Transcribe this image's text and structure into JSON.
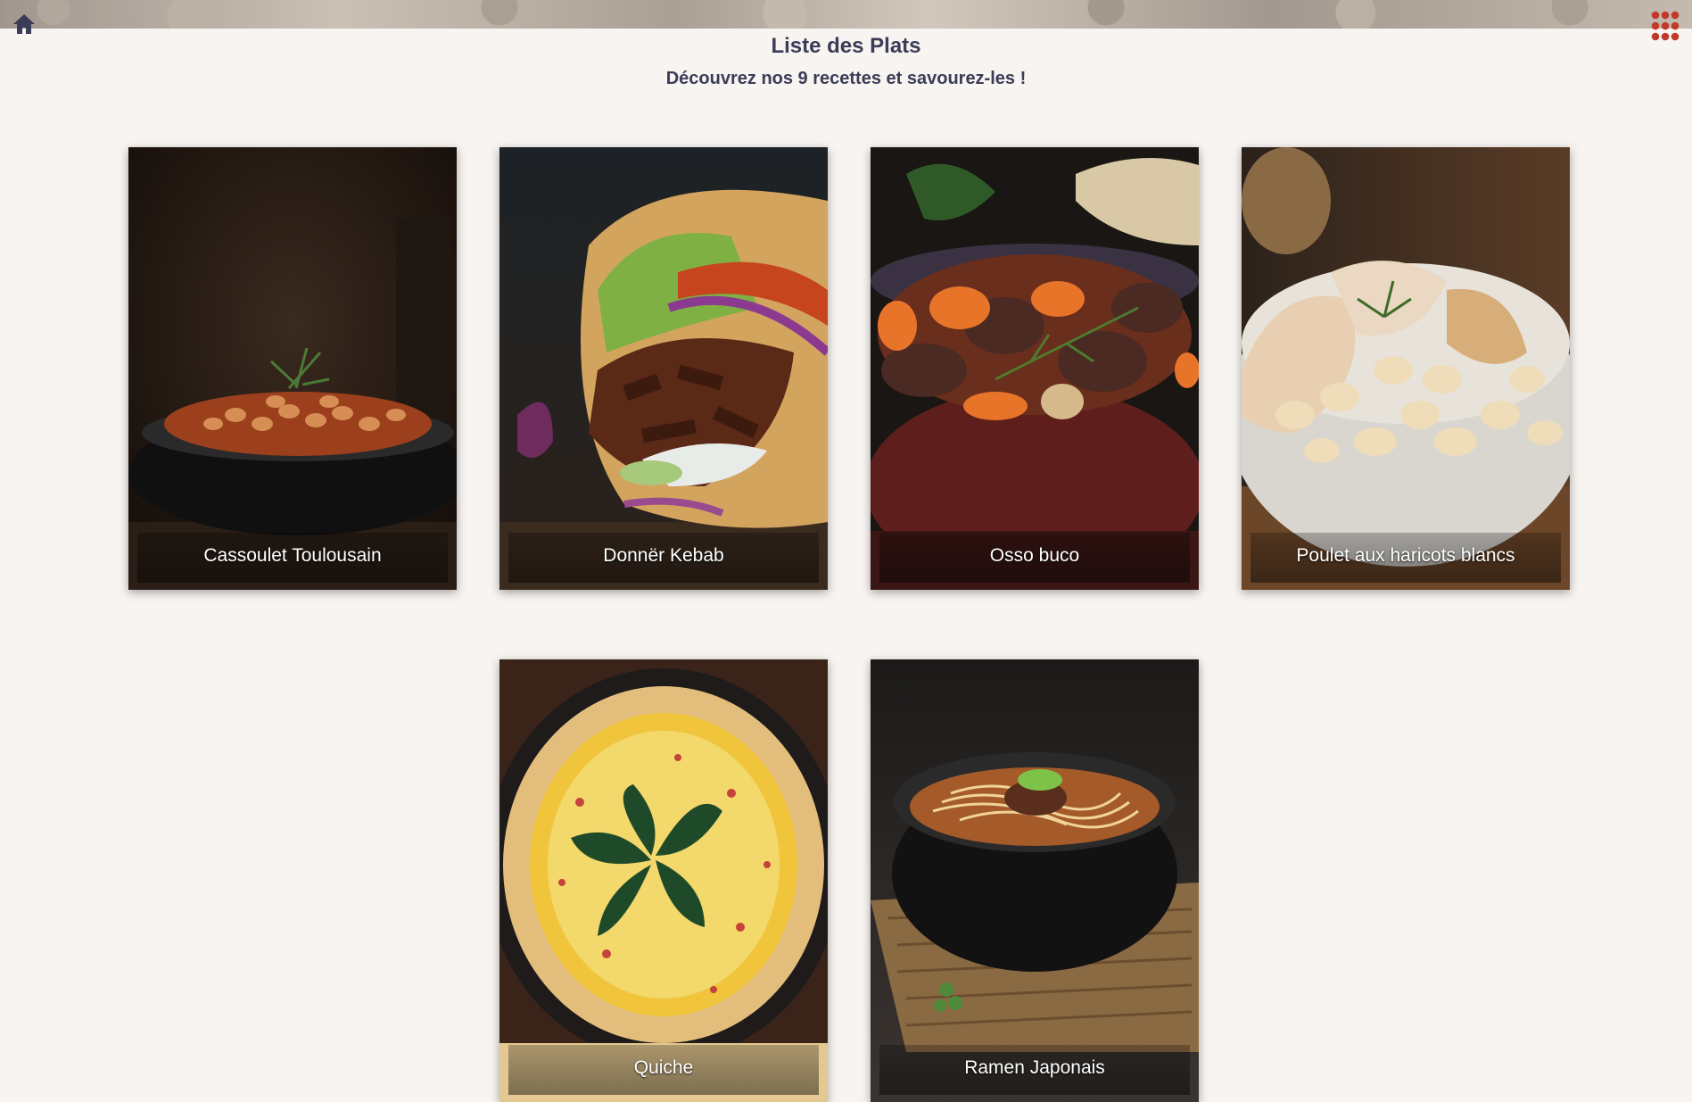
{
  "header": {
    "title": "Liste des Plats",
    "subtitle": "Découvrez nos 9 recettes et savourez-les !",
    "home_icon": "home-icon",
    "menu_icon": "grid-menu-icon",
    "menu_icon_color": "#c0392b"
  },
  "recipes": [
    {
      "name": "Cassoulet Toulousain"
    },
    {
      "name": "Donnër Kebab"
    },
    {
      "name": "Osso buco"
    },
    {
      "name": "Poulet aux haricots blancs"
    },
    {
      "name": "Quiche"
    },
    {
      "name": "Ramen Japonais"
    }
  ],
  "colors": {
    "background": "#f8f4f1",
    "text": "#3b3c57"
  }
}
